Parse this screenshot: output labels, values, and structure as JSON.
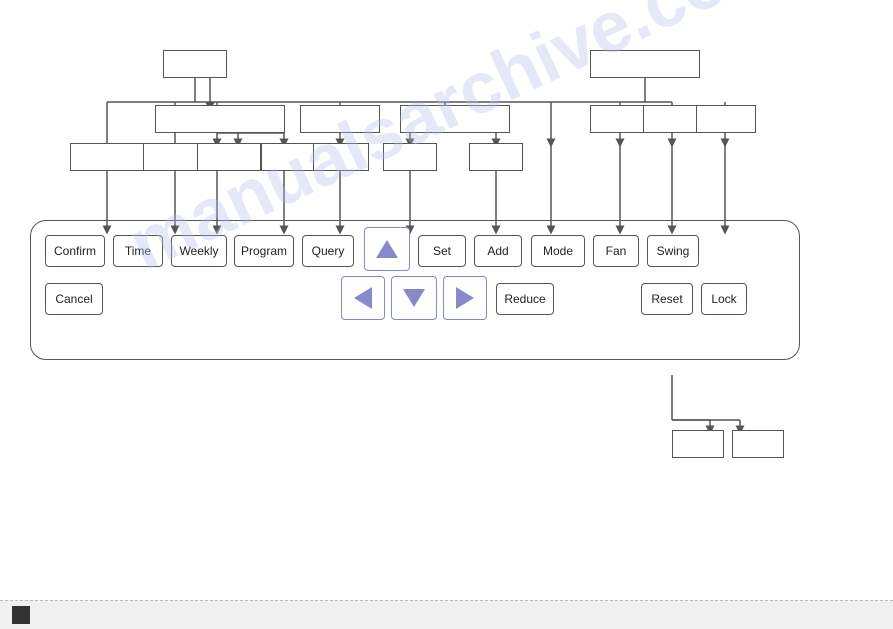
{
  "watermark": {
    "line1": "manualsarchive.com"
  },
  "buttons": {
    "confirm": "Confirm",
    "time": "Time",
    "weekly": "Weekly",
    "program": "Program",
    "query": "Query",
    "set": "Set",
    "add": "Add",
    "mode": "Mode",
    "fan": "Fan",
    "swing": "Swing",
    "cancel": "Cancel",
    "reduce": "Reduce",
    "reset": "Reset",
    "lock": "Lock"
  }
}
